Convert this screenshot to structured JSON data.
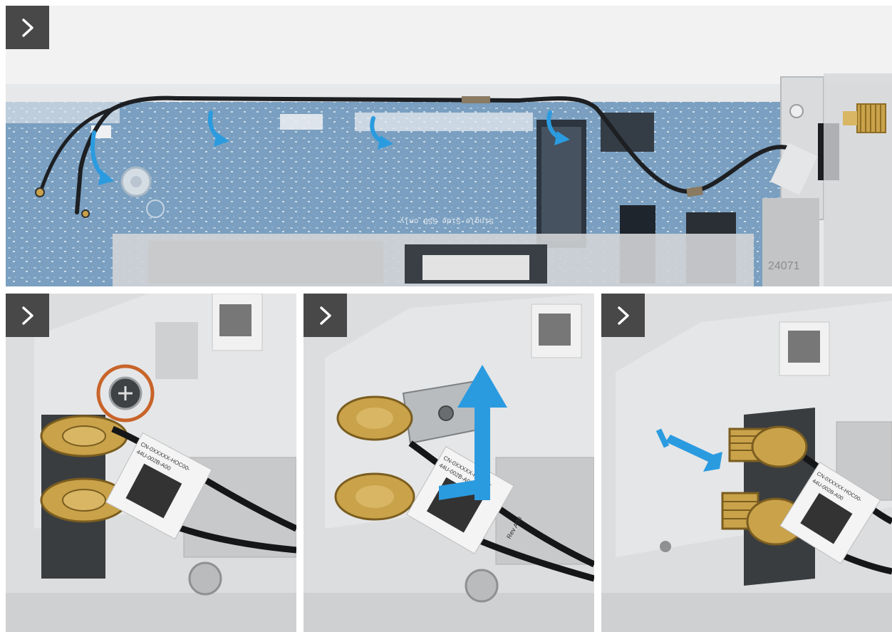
{
  "colors": {
    "step_button": "#484848",
    "board_blue": "#3f78a8",
    "arrow_blue": "#2b9be0",
    "highlight_ring": "#c8642a",
    "chassis_gray": "#cfd1d3",
    "gold_connector": "#c9a24a"
  },
  "icons": {
    "step": "chevron-right-icon",
    "route": "curved-arrow-icon",
    "remove": "lift-arrow-icon",
    "slide": "slide-arrow-icon",
    "screw": "screw-icon"
  },
  "panels": [
    {
      "id": "panel-1",
      "board_text": [
        "Single Side SSD only",
        "24071"
      ]
    },
    {
      "id": "panel-2",
      "label_text": [
        "CN-0XXXXX-HOC00-",
        "44U-002B-A00"
      ]
    },
    {
      "id": "panel-3",
      "label_text": [
        "CN-0XXXXX-HOC00-",
        "44U-002B-A00",
        "Rev A00"
      ]
    },
    {
      "id": "panel-4",
      "label_text": [
        "CN-0XXXXX-HOC00-",
        "44U-002B-A00"
      ]
    }
  ]
}
